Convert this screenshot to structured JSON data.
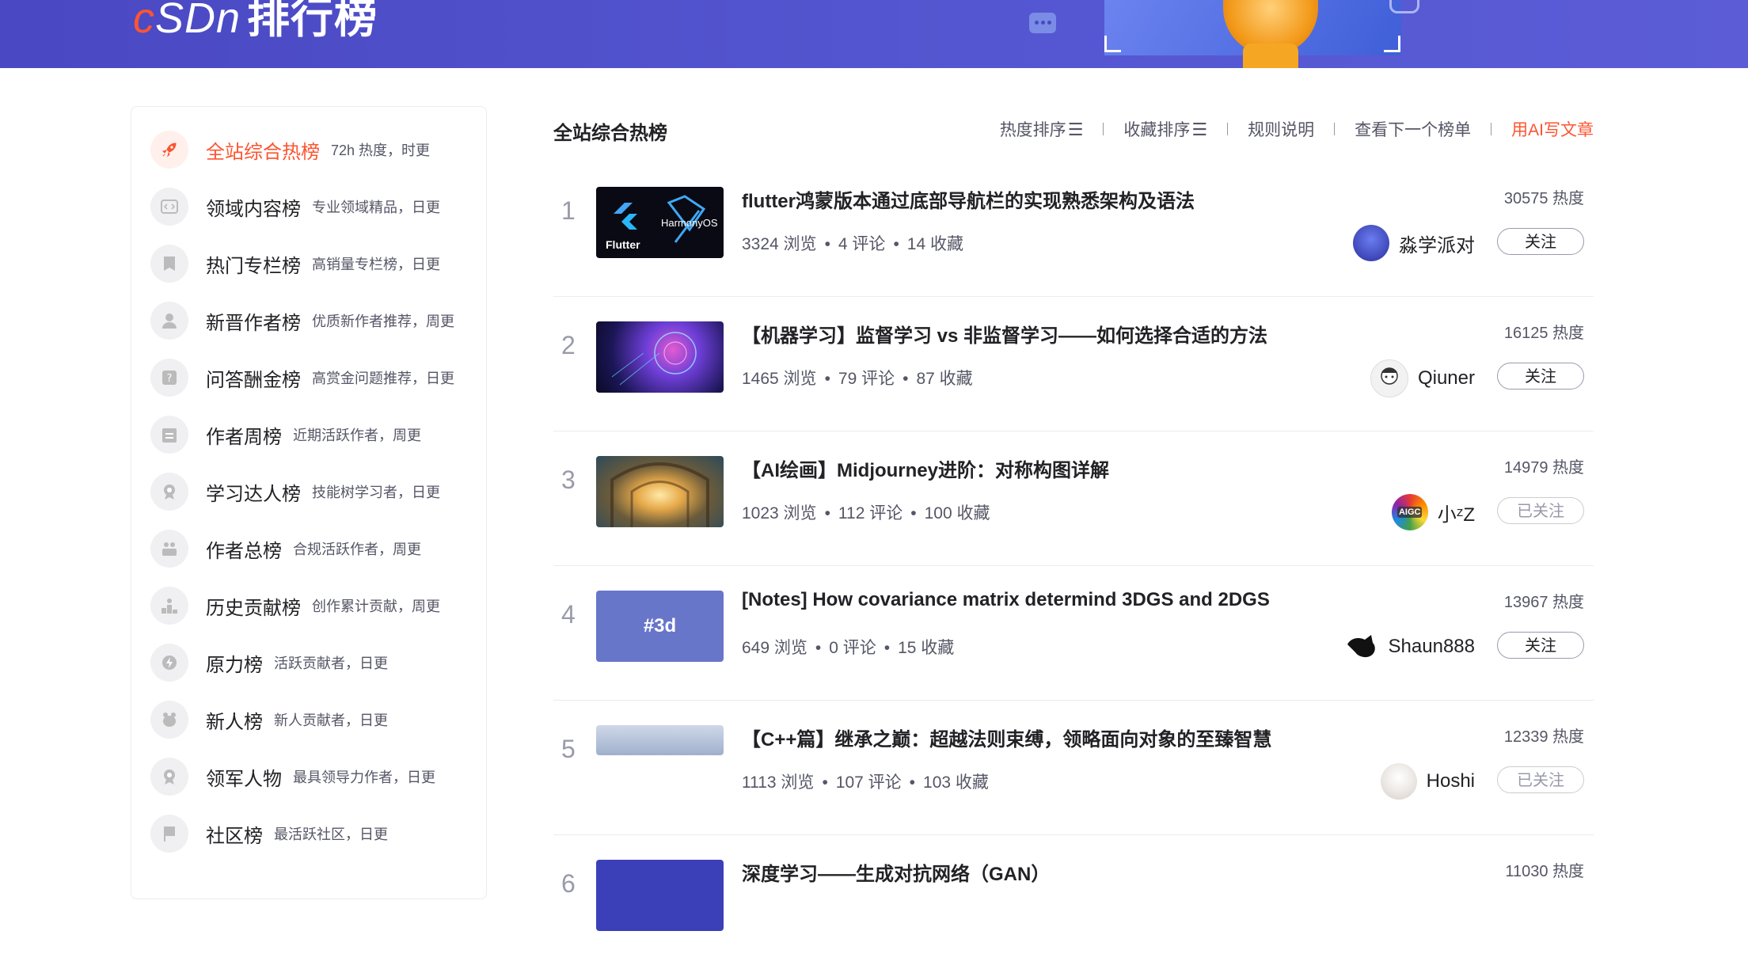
{
  "header": {
    "logo_c": "c",
    "logo_sdn": "SDn",
    "logo_title": "排行榜"
  },
  "sidebar": {
    "items": [
      {
        "title": "全站综合热榜",
        "desc": "72h 热度，时更",
        "icon": "rocket-icon",
        "active": true
      },
      {
        "title": "领域内容榜",
        "desc": "专业领域精品，日更",
        "icon": "code-icon"
      },
      {
        "title": "热门专栏榜",
        "desc": "高销量专栏榜，日更",
        "icon": "book-icon"
      },
      {
        "title": "新晋作者榜",
        "desc": "优质新作者推荐，周更",
        "icon": "user-icon"
      },
      {
        "title": "问答酬金榜",
        "desc": "高赏金问题推荐，日更",
        "icon": "question-icon"
      },
      {
        "title": "作者周榜",
        "desc": "近期活跃作者，周更",
        "icon": "calendar-icon"
      },
      {
        "title": "学习达人榜",
        "desc": "技能树学习者，日更",
        "icon": "medal-icon"
      },
      {
        "title": "作者总榜",
        "desc": "合规活跃作者，周更",
        "icon": "team-icon"
      },
      {
        "title": "历史贡献榜",
        "desc": "创作累计贡献，周更",
        "icon": "podium-icon"
      },
      {
        "title": "原力榜",
        "desc": "活跃贡献者，日更",
        "icon": "force-icon"
      },
      {
        "title": "新人榜",
        "desc": "新人贡献者，日更",
        "icon": "newbie-icon"
      },
      {
        "title": "领军人物",
        "desc": "最具领导力作者，日更",
        "icon": "leader-icon"
      },
      {
        "title": "社区榜",
        "desc": "最活跃社区，日更",
        "icon": "flag-icon"
      }
    ]
  },
  "main": {
    "title": "全站综合热榜",
    "actions": {
      "hot_sort": "热度排序",
      "fav_sort": "收藏排序",
      "rules": "规则说明",
      "next": "查看下一个榜单",
      "ai_write": "用AI写文章"
    },
    "articles": [
      {
        "rank": "1",
        "title": "flutter鸿蒙版本通过底部导航栏的实现熟悉架构及语法",
        "views": "3324 浏览",
        "comments": "4 评论",
        "favs": "14 收藏",
        "heat": "30575 热度",
        "author": "淼学派对",
        "follow": "关注",
        "followed": false,
        "thumb_text_1": "Flutter",
        "thumb_text_2": "HarmonyOS"
      },
      {
        "rank": "2",
        "title": "【机器学习】监督学习 vs 非监督学习——如何选择合适的方法",
        "views": "1465 浏览",
        "comments": "79 评论",
        "favs": "87 收藏",
        "heat": "16125 热度",
        "author": "Qiuner",
        "follow": "关注",
        "followed": false
      },
      {
        "rank": "3",
        "title": "【AI绘画】Midjourney进阶：对称构图详解",
        "views": "1023 浏览",
        "comments": "112 评论",
        "favs": "100 收藏",
        "heat": "14979 热度",
        "author": "小ᶻZ",
        "follow": "已关注",
        "followed": true,
        "avatar_text": "AIGC"
      },
      {
        "rank": "4",
        "title": "[Notes] How covariance matrix determind 3DGS and 2DGS",
        "views": "649 浏览",
        "comments": "0 评论",
        "favs": "15 收藏",
        "heat": "13967 热度",
        "author": "Shaun888",
        "follow": "关注",
        "followed": false,
        "thumb_text_1": "#3d"
      },
      {
        "rank": "5",
        "title": "【C++篇】继承之巅：超越法则束缚，领略面向对象的至臻智慧",
        "views": "1113 浏览",
        "comments": "107 评论",
        "favs": "103 收藏",
        "heat": "12339 热度",
        "author": "Hoshi",
        "follow": "已关注",
        "followed": true
      },
      {
        "rank": "6",
        "title": "深度学习——生成对抗网络（GAN）",
        "heat": "11030 热度"
      }
    ]
  },
  "colors": {
    "accent": "#fc5531",
    "banner": "#5456d1"
  }
}
